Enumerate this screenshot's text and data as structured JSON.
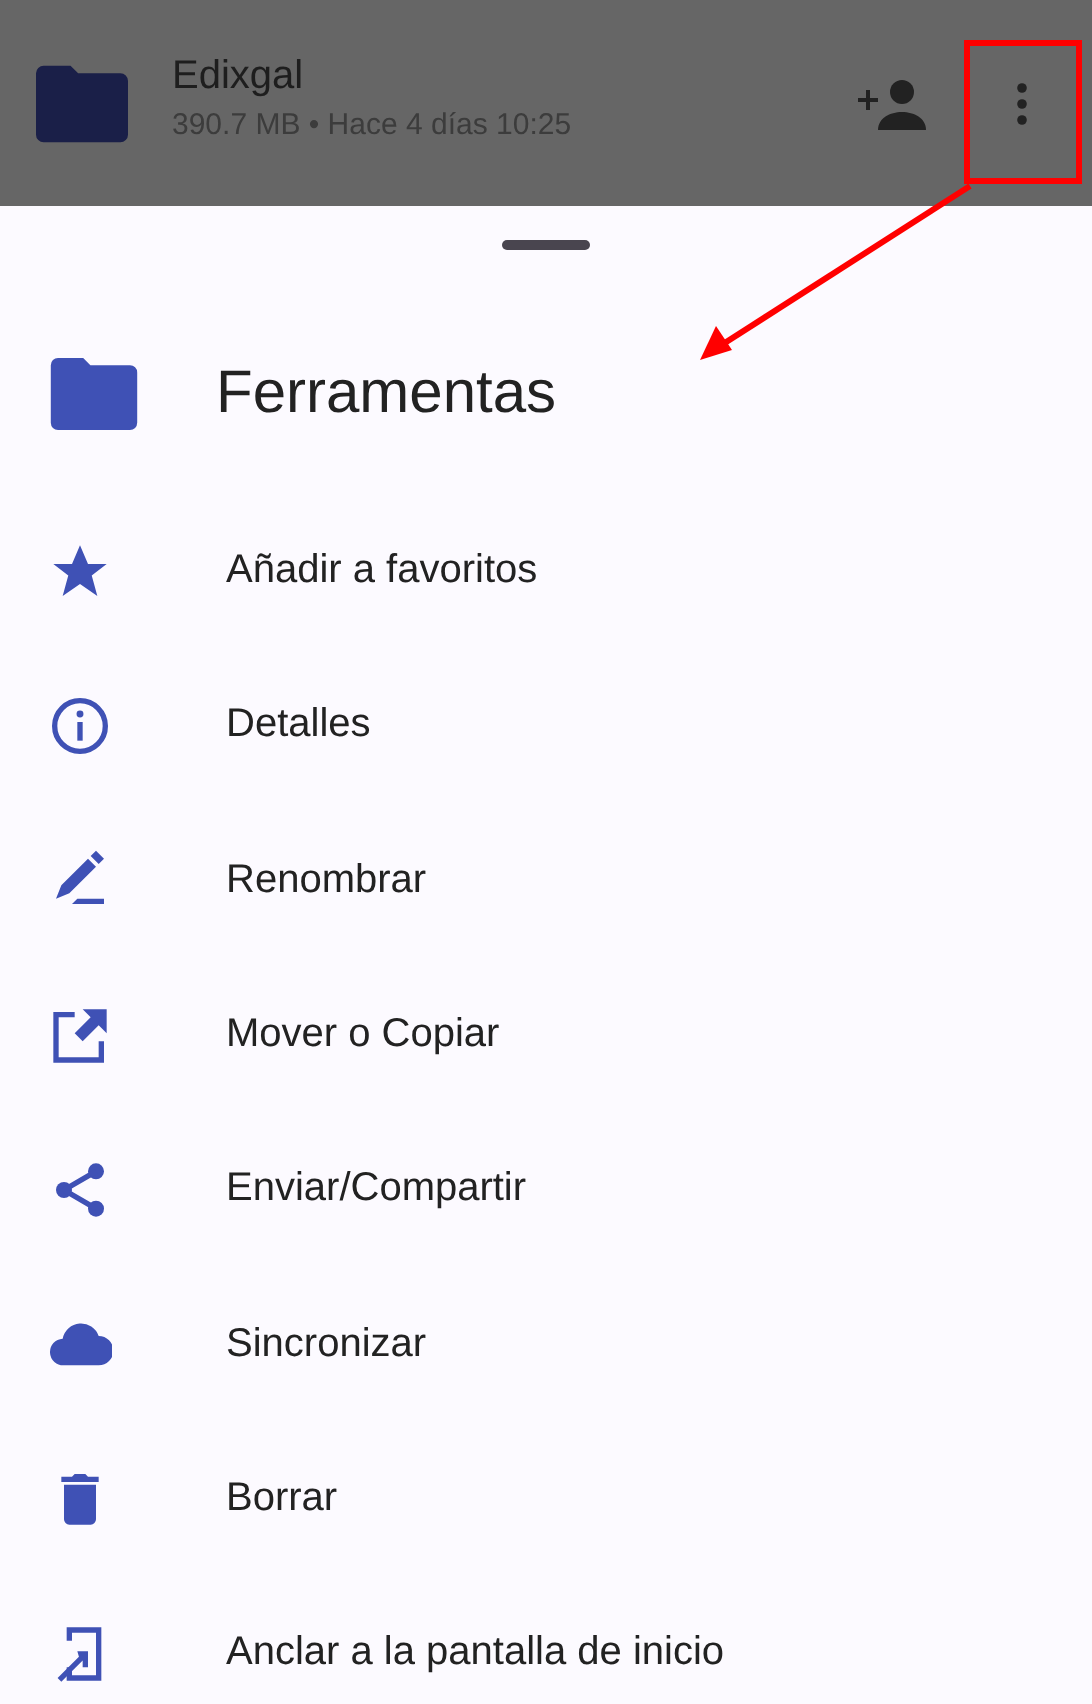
{
  "file_bar": {
    "name": "Edixgal",
    "meta": "390.7 MB • Hace 4 días 10:25"
  },
  "sheet": {
    "title": "Ferramentas",
    "items": [
      {
        "kind": "star",
        "label": "Añadir a favoritos"
      },
      {
        "kind": "info",
        "label": "Detalles"
      },
      {
        "kind": "rename",
        "label": "Renombrar"
      },
      {
        "kind": "move",
        "label": "Mover o Copiar"
      },
      {
        "kind": "share",
        "label": "Enviar/Compartir"
      },
      {
        "kind": "sync",
        "label": "Sincronizar"
      },
      {
        "kind": "delete",
        "label": "Borrar"
      },
      {
        "kind": "pin",
        "label": "Anclar a la pantalla de inicio"
      }
    ]
  }
}
